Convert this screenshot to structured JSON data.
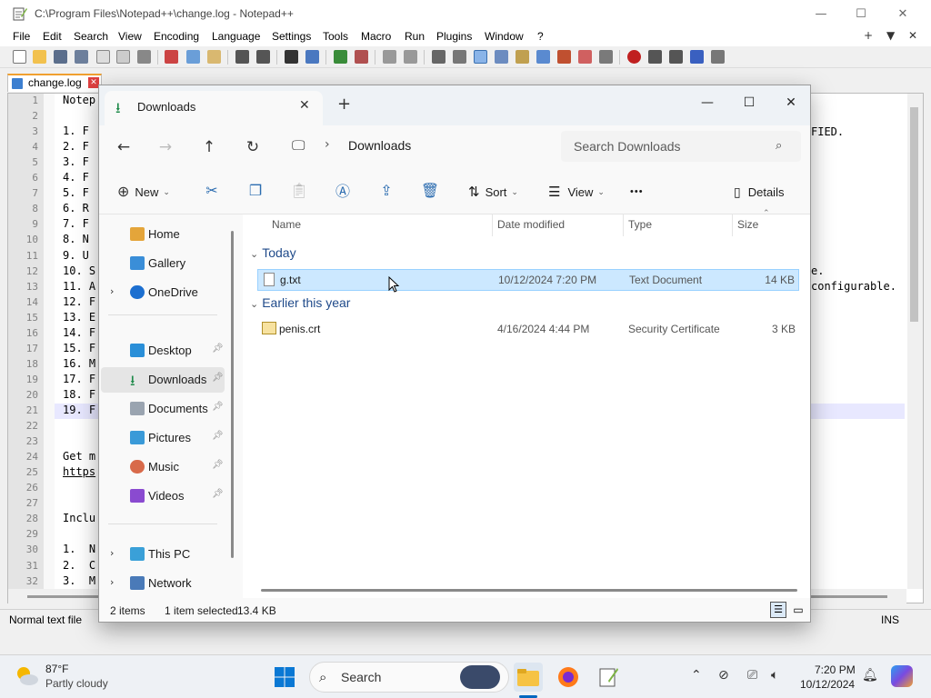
{
  "notepad": {
    "title": "C:\\Program Files\\Notepad++\\change.log - Notepad++",
    "menus": [
      "File",
      "Edit",
      "Search",
      "View",
      "Encoding",
      "Language",
      "Settings",
      "Tools",
      "Macro",
      "Run",
      "Plugins",
      "Window",
      "?"
    ],
    "menu_right": [
      "+",
      "▼",
      "✕"
    ],
    "tab_label": "change.log",
    "line_numbers": [
      "1",
      "2",
      "3",
      "4",
      "5",
      "6",
      "7",
      "8",
      "9",
      "10",
      "11",
      "12",
      "13",
      "14",
      "15",
      "16",
      "17",
      "18",
      "19",
      "20",
      "21",
      "22",
      "23",
      "24",
      "25",
      "26",
      "27",
      "28",
      "29",
      "30",
      "31",
      "32"
    ],
    "code_lines": [
      "Notep",
      "",
      "1. F",
      "2. F",
      "3. F",
      "4. F",
      "5. F",
      "6. R",
      "7. F",
      "8. N",
      "9. U",
      "10. S",
      "11. A",
      "12. F",
      "13. E",
      "14. F",
      "15. F",
      "16. M",
      "17. F",
      "18. F",
      "19. F",
      "",
      "",
      "Get m",
      "https",
      "",
      "",
      "Inclu",
      "",
      "1.  N",
      "2.  C",
      "3.  M"
    ],
    "right_fragments": [
      "FIED.",
      "e.",
      "configurable."
    ],
    "status": {
      "doc_type": "Normal text file",
      "ins": "INS"
    }
  },
  "explorer": {
    "tab_title": "Downloads",
    "address": "Downloads",
    "search_placeholder": "Search Downloads",
    "commands": {
      "new": "New",
      "sort": "Sort",
      "view": "View",
      "more": "•••",
      "details": "Details"
    },
    "nav": {
      "home": "Home",
      "gallery": "Gallery",
      "onedrive": "OneDrive",
      "desktop": "Desktop",
      "downloads": "Downloads",
      "documents": "Documents",
      "pictures": "Pictures",
      "music": "Music",
      "videos": "Videos",
      "thispc": "This PC",
      "network": "Network"
    },
    "columns": {
      "name": "Name",
      "date": "Date modified",
      "type": "Type",
      "size": "Size"
    },
    "groups": [
      {
        "label": "Today",
        "files": [
          {
            "name": "g.txt",
            "date": "10/12/2024 7:20 PM",
            "type": "Text Document",
            "size": "14 KB"
          }
        ]
      },
      {
        "label": "Earlier this year",
        "files": [
          {
            "name": "penis.crt",
            "date": "4/16/2024 4:44 PM",
            "type": "Security Certificate",
            "size": "3 KB"
          }
        ]
      }
    ],
    "status": {
      "count": "2 items",
      "selected": "1 item selected",
      "size": "13.4 KB"
    }
  },
  "taskbar": {
    "temp": "87°F",
    "weather": "Partly cloudy",
    "search": "Search",
    "time": "7:20 PM",
    "date": "10/12/2024"
  },
  "colors": {
    "accent": "#0067c0",
    "selection": "#cce8ff",
    "selection_border": "#99d1ff",
    "nav_selected": "#e5e5e5"
  }
}
